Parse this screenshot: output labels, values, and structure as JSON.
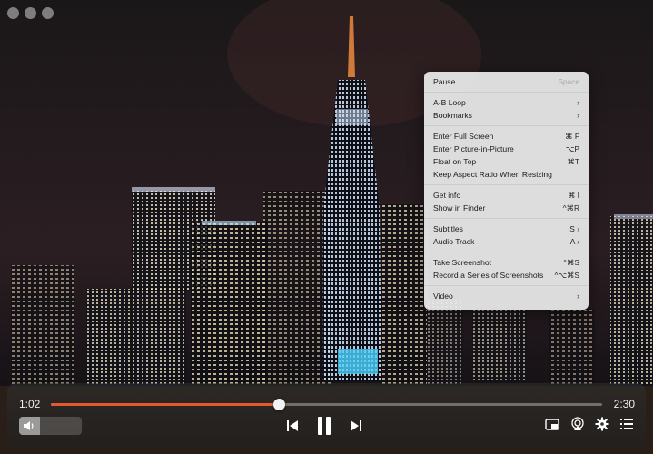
{
  "colors": {
    "accent": "#e35a2e",
    "menu_bg": "#ececec"
  },
  "player": {
    "current_time": "1:02",
    "total_time": "2:30",
    "progress_fraction": 0.413,
    "volume_fraction": 0.33
  },
  "icons": {
    "volume": "speaker-icon",
    "prev": "previous-track-icon",
    "play": "pause-icon",
    "next": "next-track-icon",
    "pip": "picture-in-picture-icon",
    "airplay": "airplay-icon",
    "settings": "gear-icon",
    "playlist": "playlist-icon"
  },
  "menu": {
    "pause": {
      "label": "Pause",
      "shortcut": "Space"
    },
    "ab_loop": {
      "label": "A-B Loop",
      "chev": "›"
    },
    "bookmarks": {
      "label": "Bookmarks",
      "chev": "›"
    },
    "fullscreen": {
      "label": "Enter Full Screen",
      "shortcut": "⌘ F"
    },
    "pip": {
      "label": "Enter Picture-in-Picture",
      "shortcut": "⌥P"
    },
    "float": {
      "label": "Float on Top",
      "shortcut": "⌘T"
    },
    "aspect": {
      "label": "Keep Aspect Ratio When Resizing"
    },
    "info": {
      "label": "Get info",
      "shortcut": "⌘ I"
    },
    "finder": {
      "label": "Show in Finder",
      "shortcut": "^⌘R"
    },
    "subtitles": {
      "label": "Subtitles",
      "shortcut": "S ›"
    },
    "audio": {
      "label": "Audio Track",
      "shortcut": "A ›"
    },
    "screenshot": {
      "label": "Take Screenshot",
      "shortcut": "^⌘S"
    },
    "series": {
      "label": "Record a Series of Screenshots",
      "shortcut": "^⌥⌘S"
    },
    "video": {
      "label": "Video",
      "chev": "›"
    }
  }
}
